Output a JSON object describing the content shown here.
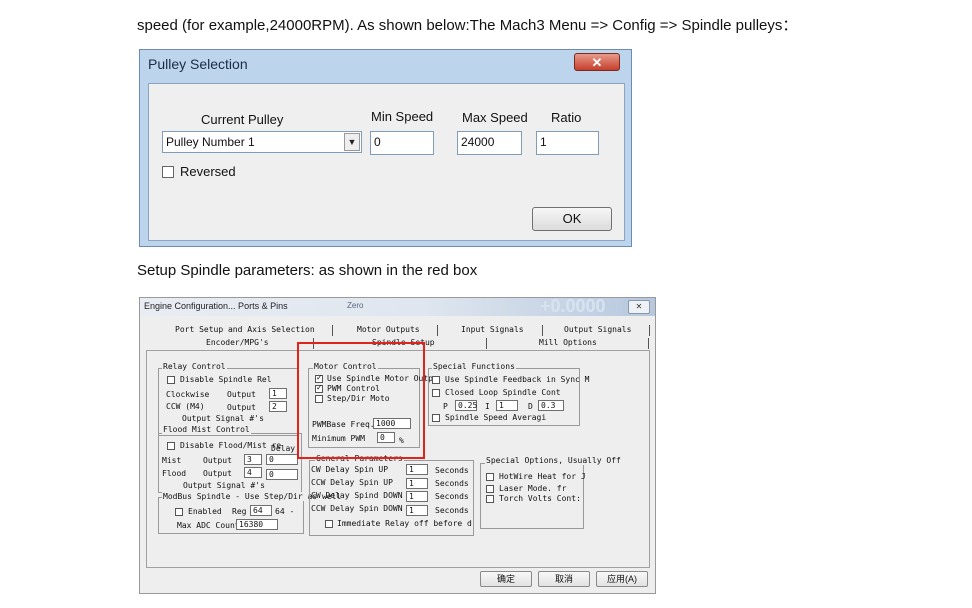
{
  "doc": {
    "line1": "speed (for example,24000RPM). As shown below:The Mach3 Menu => Config => Spindle pulleys：",
    "line2": "Setup Spindle parameters: as shown in the red box"
  },
  "pulley_dialog": {
    "title": "Pulley Selection",
    "close_glyph": "✕",
    "current_pulley_label": "Current Pulley",
    "current_pulley_value": "Pulley Number 1",
    "dropdown_glyph": "▼",
    "min_speed_label": "Min Speed",
    "min_speed_value": "0",
    "max_speed_label": "Max Speed",
    "max_speed_value": "24000",
    "ratio_label": "Ratio",
    "ratio_value": "1",
    "reversed_label": "Reversed",
    "ok_label": "OK"
  },
  "engine_dialog": {
    "title": "Engine Configuration... Ports & Pins",
    "bg_number": "+0.0000",
    "bg_label": "Zero",
    "tabs_row1": [
      "Port Setup and Axis Selection",
      "Motor Outputs",
      "Input Signals",
      "Output Signals"
    ],
    "tabs_row2": [
      "Encoder/MPG's",
      "Spindle Setup",
      "Mill Options"
    ],
    "relay": {
      "title": "Relay Control",
      "disable": "Disable Spindle Rel",
      "cw_label": "Clockwise",
      "ccw_label": "CCW (M4)",
      "output_label": "Output",
      "cw_output": "1",
      "ccw_output": "2",
      "signals_label": "Output Signal #'s"
    },
    "flood": {
      "title": "Flood Mist Control",
      "disable": "Disable Flood/Mist re",
      "delay_label": "Delay",
      "mist_label": "Mist",
      "flood_label": "Flood",
      "output_label": "Output",
      "mist_output": "3",
      "mist_delay": "0",
      "flood_output": "4",
      "flood_delay": "0",
      "signals_label": "Output Signal #'s"
    },
    "modbus": {
      "title": "ModBus Spindle - Use Step/Dir as well",
      "enabled": "Enabled",
      "reg_label": "Reg",
      "reg_value": "64",
      "reg_range": "64 -",
      "max_adc_label": "Max ADC Count",
      "max_adc_value": "16380"
    },
    "motor": {
      "title": "Motor Control",
      "use_motor": "Use Spindle Motor Outp",
      "pwm": "PWM Control",
      "stepdir": "Step/Dir Moto",
      "pwm_freq_label": "PWMBase Freq.",
      "pwm_freq_value": "1000",
      "min_pwm_label": "Minimum PWM",
      "min_pwm_value": "0",
      "min_pwm_unit": "%"
    },
    "general": {
      "title": "General Parameters",
      "rows": [
        {
          "label": "CW Delay Spin UP",
          "value": "1",
          "unit": "Seconds"
        },
        {
          "label": "CCW Delay Spin UP",
          "value": "1",
          "unit": "Seconds"
        },
        {
          "label": "CW Delay Spind DOWN",
          "value": "1",
          "unit": "Seconds"
        },
        {
          "label": "CCW Delay Spin DOWN",
          "value": "1",
          "unit": "Seconds"
        }
      ],
      "immediate": "Immediate Relay off before d"
    },
    "special": {
      "title": "Special Functions",
      "feedback": "Use Spindle Feedback in Sync M",
      "closed_loop": "Closed Loop Spindle Cont",
      "p_label": "P",
      "p_value": "0.25",
      "i_label": "I",
      "i_value": "1",
      "d_label": "D",
      "d_value": "0.3",
      "averaging": "Spindle Speed Averagi"
    },
    "special_options": {
      "title": "Special Options, Usually Off",
      "hotwire": "HotWire Heat for J",
      "laser": "Laser Mode. fr",
      "torch": "Torch Volts Cont:"
    },
    "buttons": {
      "ok": "确定",
      "cancel": "取消",
      "apply": "应用(A)"
    }
  }
}
